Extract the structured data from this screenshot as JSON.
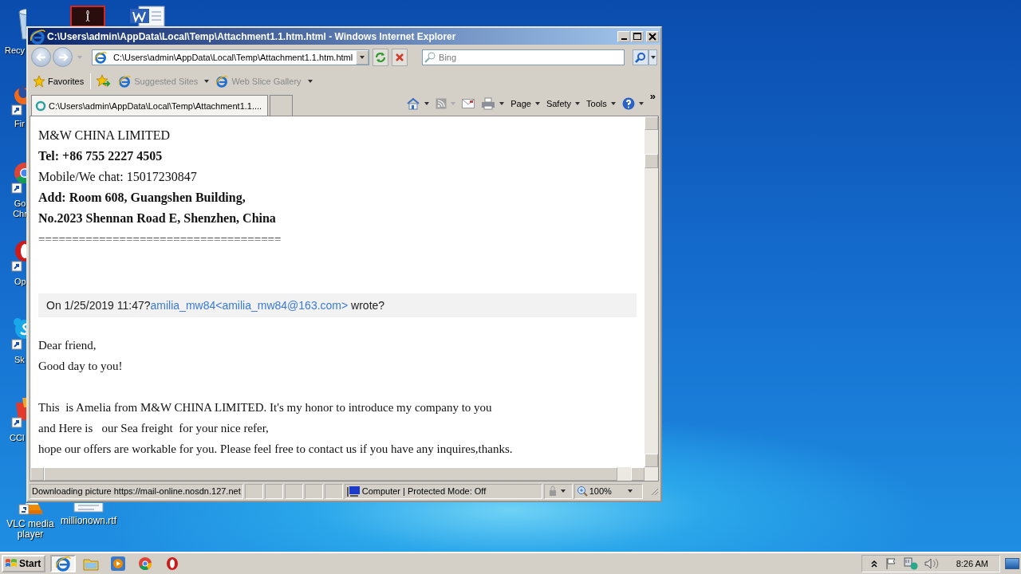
{
  "desktop_icons": [
    {
      "kind": "recycle",
      "label": "Recy"
    },
    {
      "kind": "firefox",
      "label": "Fir"
    },
    {
      "kind": "chrome",
      "label": "Go Chr"
    },
    {
      "kind": "opera",
      "label": "Op"
    },
    {
      "kind": "skype",
      "label": "Sk"
    },
    {
      "kind": "ccleaner",
      "label": "CCl"
    },
    {
      "kind": "vlc",
      "label": "VLC media player"
    },
    {
      "kind": "acrobat"
    },
    {
      "kind": "rtf",
      "label": "millionown.rtf"
    },
    {
      "kind": "word"
    }
  ],
  "window": {
    "title": "C:\\Users\\admin\\AppData\\Local\\Temp\\Attachment1.1.htm.html - Windows Internet Explorer",
    "address": "C:\\Users\\admin\\AppData\\Local\\Temp\\Attachment1.1.htm.html",
    "search": {
      "placeholder": "Bing"
    },
    "favorites_bar": [
      {
        "kind": "favorites",
        "label": "Favorites"
      },
      {
        "kind": "add"
      },
      {
        "kind": "link",
        "label": "Suggested Sites"
      },
      {
        "kind": "link",
        "label": "Web Slice Gallery"
      }
    ],
    "tabs": [
      {
        "label": "C:\\Users\\admin\\AppData\\Local\\Temp\\Attachment1.1....",
        "selected": true
      }
    ],
    "command_bar": [
      {
        "kind": "home"
      },
      {
        "kind": "feeds",
        "disabled": true
      },
      {
        "kind": "mail"
      },
      {
        "kind": "print"
      },
      {
        "kind": "menu",
        "label": "Page"
      },
      {
        "kind": "menu",
        "label": "Safety"
      },
      {
        "kind": "menu",
        "label": "Tools"
      },
      {
        "kind": "help"
      },
      {
        "kind": "more",
        "label": "»"
      }
    ],
    "content": {
      "signature": [
        {
          "text": "M&W CHINA LIMITED",
          "bold": false
        },
        {
          "text": "Tel: +86 755 2227 4505",
          "bold": true
        },
        {
          "text": "Mobile/We chat: 15017230847",
          "bold": false
        },
        {
          "text": "Add: Room 608, Guangshen Building,",
          "bold": true
        },
        {
          "text": "No.2023 Shennan Road E, Shenzhen, China",
          "bold": true
        }
      ],
      "separator": "====================================",
      "quote": {
        "prefix": "On 1/25/2019 11:47?",
        "link": "amilia_mw84<amilia_mw84@163.com>",
        "suffix": " wrote?"
      },
      "paragraphs": [
        [
          "Dear friend,",
          "Good day to you!"
        ],
        [
          "This  is Amelia from M&W CHINA LIMITED. It's my honor to introduce my company to you",
          "and Here is   our Sea freight  for your nice refer,",
          "hope our offers are workable for you. Please feel free to contact us if you have any inquires,thanks."
        ]
      ]
    },
    "status_bar": {
      "text": "Downloading picture https://mail-online.nosdn.127.net",
      "zone": "Computer | Protected Mode: Off",
      "zoom": "100%"
    }
  },
  "taskbar": {
    "start": "Start",
    "apps": [
      {
        "kind": "ie",
        "selected": true
      },
      {
        "kind": "explorer",
        "selected": false
      },
      {
        "kind": "media",
        "selected": false
      },
      {
        "kind": "chrome",
        "selected": false
      },
      {
        "kind": "opera",
        "selected": false
      }
    ],
    "time": "8:26 AM"
  }
}
